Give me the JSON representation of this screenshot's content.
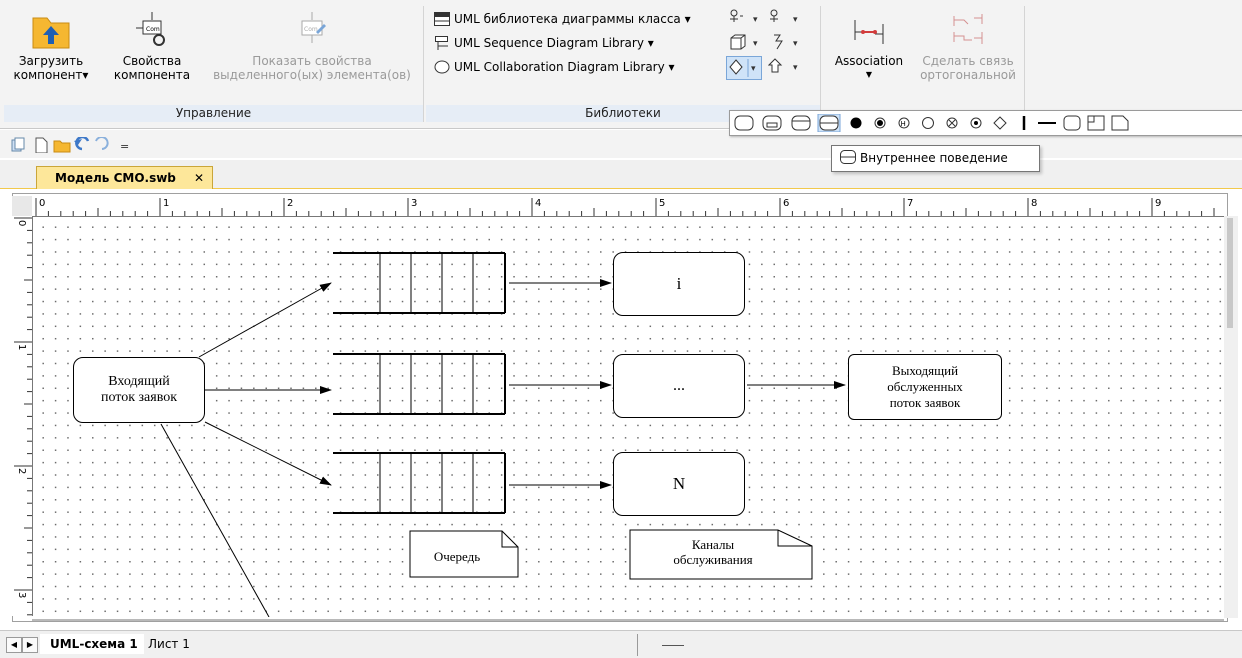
{
  "ribbon": {
    "manage": {
      "group_label": "Управление",
      "load_component": [
        "Загрузить",
        "компонент▾"
      ],
      "component_props": [
        "Свойства",
        "компонента"
      ],
      "show_props": [
        "Показать свойства",
        "выделенного(ых) элемента(ов)"
      ]
    },
    "libraries": {
      "group_label": "Библиотеки",
      "class_lib": "UML библиотека диаграммы класса ▾",
      "sequence_lib": "UML Sequence Diagram Library ▾",
      "collab_lib": "UML Collaboration Diagram Library ▾"
    },
    "connections": {
      "association": "Association",
      "make_orthogonal": [
        "Сделать связь",
        "ортогональной"
      ]
    }
  },
  "tooltip": "Внутреннее поведение",
  "document_tab": "Модель СМО.swb",
  "ruler": {
    "h_labels": [
      "0",
      "1",
      "2",
      "3",
      "4",
      "5",
      "6",
      "7",
      "8",
      "9"
    ],
    "v_labels": [
      "0",
      "1",
      "2",
      "3"
    ]
  },
  "diagram": {
    "incoming": [
      "Входящий",
      "поток заявок"
    ],
    "channel_1": "i",
    "channel_2": "...",
    "channel_3": "N",
    "outgoing": [
      "Выходящий",
      "обслуженных",
      "поток заявок"
    ],
    "queue_note": "Очередь",
    "channels_note": [
      "Каналы",
      "обслуживания"
    ]
  },
  "sheets": {
    "active": "UML-схема 1",
    "other": "Лист 1"
  },
  "colors": {
    "tab_yellow": "#fde79a",
    "group_label_bg": "#e6edf6",
    "folder": "#f5b731"
  }
}
